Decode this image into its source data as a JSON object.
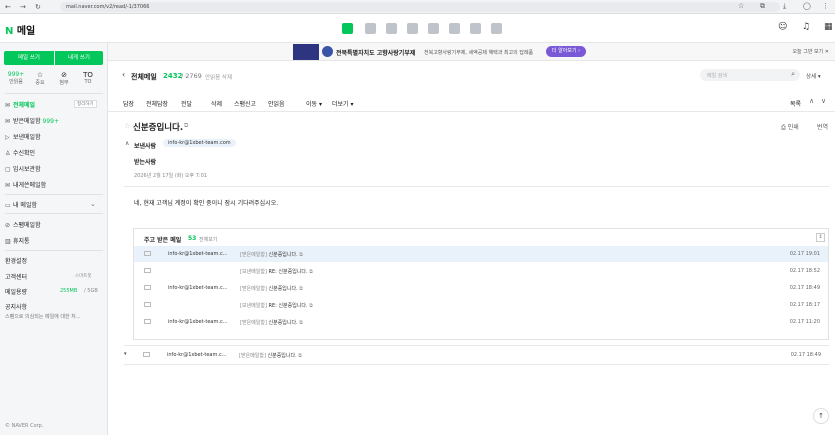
{
  "browser": {
    "url": "mail.naver.com/v2/read/-1/37066"
  },
  "top": {
    "logo_n": "N",
    "logo_text": "메일"
  },
  "sidebar": {
    "write": "메일 쓰기",
    "write_me": "내게 쓰기",
    "quick": [
      {
        "big": "999+",
        "label": "안읽음"
      },
      {
        "big": "☆",
        "label": "중요"
      },
      {
        "big": "⊘",
        "label": "첨부"
      },
      {
        "big": "TO",
        "label": "TO"
      }
    ],
    "items": [
      {
        "icon": "✉",
        "label": "전체메일",
        "badge": "정리하기"
      },
      {
        "icon": "✉",
        "label": "받은메일함",
        "count": "999+"
      },
      {
        "icon": "▷",
        "label": "보낸메일함"
      },
      {
        "icon": "♙",
        "label": "수신확인"
      },
      {
        "icon": "▢",
        "label": "임시보관함"
      },
      {
        "icon": "✉",
        "label": "내게쓴메일함"
      }
    ],
    "my_box": "내 메일함",
    "spam": "스팸메일함",
    "trash": "휴지통",
    "settings": "환경설정",
    "support": "고객센터",
    "support_badge": "스마트봇",
    "usage_label": "메일용량",
    "usage_used": "255MB",
    "usage_total": "/ 5GB",
    "notice_title": "공지사항",
    "notice_text": "스팸으로 의심되는 메일에 대한 처...",
    "copyright": "© NAVER Corp."
  },
  "ad": {
    "title": "전북특별자치도 고향사랑기부제",
    "desc": "전북고향사랑기부제, 세액공제 혜택과 최고의 답례품",
    "button": "더 알아보기 ›",
    "close": "오늘 그만 보기 ✕"
  },
  "header": {
    "back": "‹",
    "folder": "전체메일",
    "unread": "2432",
    "total": "/ 2769",
    "delete_unread": "안읽음 삭제",
    "search_placeholder": "메일 검색",
    "detail": "상세 ▾"
  },
  "toolbar": {
    "reply": "답장",
    "reply_all": "전체답장",
    "forward": "전달",
    "delete": "삭제",
    "spam": "스팸신고",
    "unread": "안읽음",
    "move": "이동 ▾",
    "more": "더보기 ▾",
    "list": "목록"
  },
  "mail": {
    "subject": "신분증입니다.",
    "print": "인쇄",
    "translate": "번역",
    "from_label": "보낸사람",
    "from": "info-kr@1xbet-team.com",
    "to_label": "받는사람",
    "date": "2026년 2월 17일 (화) 오후 7:01",
    "body": "네, 현재 고객님 계정이 확인 중이니 잠시 기다려주십시오."
  },
  "thread": {
    "title": "주고 받은 메일",
    "count": "53",
    "view_all": "전체보기",
    "rows": [
      {
        "from": "info-kr@1xbet-team.c...",
        "folder": "[받은메일함]",
        "subject": "신분증입니다.",
        "date": "02.17 19:01",
        "highlight": true
      },
      {
        "from": "",
        "folder": "[보낸메일함]",
        "subject": "RE: 신분증입니다.",
        "date": "02.17 18:52",
        "highlight": false
      },
      {
        "from": "info-kr@1xbet-team.c...",
        "folder": "[받은메일함]",
        "subject": "신분증입니다.",
        "date": "02.17 18:49",
        "highlight": false
      },
      {
        "from": "",
        "folder": "[보낸메일함]",
        "subject": "RE: 신분증입니다.",
        "date": "02.17 18:17",
        "highlight": false
      },
      {
        "from": "info-kr@1xbet-team.c...",
        "folder": "[받은메일함]",
        "subject": "신분증입니다.",
        "date": "02.17 11:20",
        "highlight": false
      }
    ],
    "bottom_row": {
      "from": "info-kr@1xbet-team.c...",
      "folder": "[받은메일함]",
      "subject": "신분증입니다.",
      "date": "02.17 18:49"
    }
  }
}
